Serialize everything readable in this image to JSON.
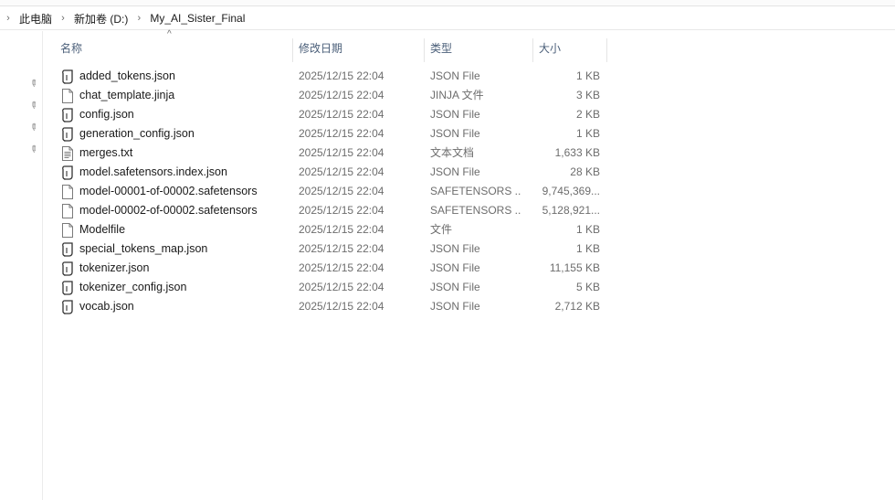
{
  "breadcrumb": {
    "items": [
      "此电脑",
      "新加卷 (D:)",
      "My_AI_Sister_Final"
    ]
  },
  "columns": {
    "name": "名称",
    "date": "修改日期",
    "type": "类型",
    "size": "大小"
  },
  "files": [
    {
      "name": "added_tokens.json",
      "date": "2025/12/15 22:04",
      "type": "JSON File",
      "size": "1 KB",
      "icon": "json-file-icon"
    },
    {
      "name": "chat_template.jinja",
      "date": "2025/12/15 22:04",
      "type": "JINJA 文件",
      "size": "3 KB",
      "icon": "generic-file-icon"
    },
    {
      "name": "config.json",
      "date": "2025/12/15 22:04",
      "type": "JSON File",
      "size": "2 KB",
      "icon": "json-file-icon"
    },
    {
      "name": "generation_config.json",
      "date": "2025/12/15 22:04",
      "type": "JSON File",
      "size": "1 KB",
      "icon": "json-file-icon"
    },
    {
      "name": "merges.txt",
      "date": "2025/12/15 22:04",
      "type": "文本文档",
      "size": "1,633 KB",
      "icon": "text-file-icon"
    },
    {
      "name": "model.safetensors.index.json",
      "date": "2025/12/15 22:04",
      "type": "JSON File",
      "size": "28 KB",
      "icon": "json-file-icon"
    },
    {
      "name": "model-00001-of-00002.safetensors",
      "date": "2025/12/15 22:04",
      "type": "SAFETENSORS ...",
      "size": "9,745,369...",
      "icon": "generic-file-icon"
    },
    {
      "name": "model-00002-of-00002.safetensors",
      "date": "2025/12/15 22:04",
      "type": "SAFETENSORS ...",
      "size": "5,128,921...",
      "icon": "generic-file-icon"
    },
    {
      "name": "Modelfile",
      "date": "2025/12/15 22:04",
      "type": "文件",
      "size": "1 KB",
      "icon": "generic-file-icon"
    },
    {
      "name": "special_tokens_map.json",
      "date": "2025/12/15 22:04",
      "type": "JSON File",
      "size": "1 KB",
      "icon": "json-file-icon"
    },
    {
      "name": "tokenizer.json",
      "date": "2025/12/15 22:04",
      "type": "JSON File",
      "size": "11,155 KB",
      "icon": "json-file-icon"
    },
    {
      "name": "tokenizer_config.json",
      "date": "2025/12/15 22:04",
      "type": "JSON File",
      "size": "5 KB",
      "icon": "json-file-icon"
    },
    {
      "name": "vocab.json",
      "date": "2025/12/15 22:04",
      "type": "JSON File",
      "size": "2,712 KB",
      "icon": "json-file-icon"
    }
  ],
  "quick_access": {
    "pin_count": 4,
    "icon": "pin-icon"
  }
}
